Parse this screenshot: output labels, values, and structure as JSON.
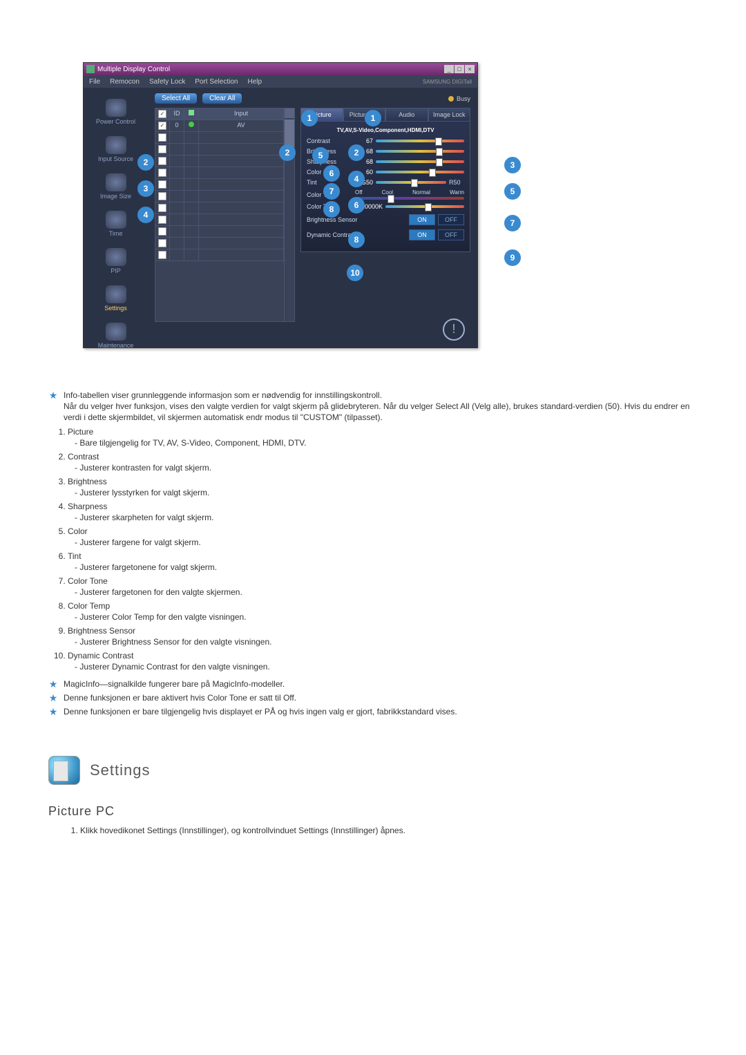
{
  "window": {
    "title": "Multiple Display Control",
    "menu": [
      "File",
      "Remocon",
      "Safety Lock",
      "Port Selection",
      "Help"
    ],
    "brand": "SAMSUNG DIGITall"
  },
  "sidebar": {
    "items": [
      {
        "label": "Power Control"
      },
      {
        "label": "Input Source"
      },
      {
        "label": "Image Size"
      },
      {
        "label": "Time"
      },
      {
        "label": "PIP"
      },
      {
        "label": "Settings"
      },
      {
        "label": "Maintenance"
      }
    ]
  },
  "topButtons": {
    "selectAll": "Select All",
    "clearAll": "Clear All",
    "busy": "Busy"
  },
  "gridHead": {
    "id": "ID",
    "input": "Input"
  },
  "gridRows": [
    {
      "id": "0",
      "input": "AV",
      "checked": true,
      "status": true
    },
    {
      "id": "",
      "input": ""
    },
    {
      "id": "",
      "input": ""
    },
    {
      "id": "",
      "input": ""
    },
    {
      "id": "",
      "input": ""
    },
    {
      "id": "",
      "input": ""
    },
    {
      "id": "",
      "input": ""
    },
    {
      "id": "",
      "input": ""
    },
    {
      "id": "",
      "input": ""
    },
    {
      "id": "",
      "input": ""
    },
    {
      "id": "",
      "input": ""
    },
    {
      "id": "",
      "input": ""
    }
  ],
  "tabs": [
    "Picture",
    "Picture PC",
    "Audio",
    "Image Lock"
  ],
  "panel": {
    "subtitle": "TV,AV,S-Video,Component,HDMI,DTV",
    "contrast": {
      "label": "Contrast",
      "value": "67"
    },
    "brightness": {
      "label": "Brightness",
      "value": "68"
    },
    "sharpness": {
      "label": "Sharpness",
      "value": "68"
    },
    "color": {
      "label": "Color",
      "value": "60"
    },
    "tint": {
      "label": "Tint",
      "left": "G50",
      "right": "R50"
    },
    "colorTone": {
      "label": "Color Tone",
      "opts": [
        "Off",
        "Cool",
        "Normal",
        "Warm"
      ]
    },
    "colorTemp": {
      "label": "Color Temp",
      "value": "10000K"
    },
    "brightnessSensor": {
      "label": "Brightness Sensor",
      "on": "ON",
      "off": "OFF"
    },
    "dynamicContrast": {
      "label": "Dynamic Contrast",
      "on": "ON",
      "off": "OFF"
    }
  },
  "callouts": {
    "c1": "1",
    "c2": "2",
    "c3": "3",
    "c4": "4",
    "c5": "5",
    "c6": "6",
    "c7": "7",
    "c8": "8",
    "c9": "9",
    "c10": "10",
    "s2": "2",
    "s3": "3",
    "s4": "4",
    "s5": "5",
    "s6": "6",
    "s7": "7",
    "s8": "8"
  },
  "intro": {
    "star1a": "Info-tabellen viser grunnleggende informasjon som er nødvendig for innstillingskontroll.",
    "star1b": "Når du velger hver funksjon, vises den valgte verdien for valgt skjerm på glidebryteren. Når du velger Select All (Velg alle), brukes standard-verdien (50). Hvis du endrer en verdi i dette skjermbildet, vil skjermen automatisk endr modus til \"CUSTOM\" (tilpasset)."
  },
  "list": [
    {
      "t": "Picture",
      "d": "- Bare tilgjengelig for TV, AV, S-Video, Component, HDMI, DTV."
    },
    {
      "t": "Contrast",
      "d": "- Justerer kontrasten for valgt skjerm."
    },
    {
      "t": "Brightness",
      "d": "- Justerer lysstyrken for valgt skjerm."
    },
    {
      "t": "Sharpness",
      "d": "- Justerer skarpheten for valgt skjerm."
    },
    {
      "t": "Color",
      "d": "- Justerer fargene for valgt skjerm."
    },
    {
      "t": "Tint",
      "d": "- Justerer fargetonene for valgt skjerm."
    },
    {
      "t": "Color Tone",
      "d": "- Justerer fargetonen for den valgte skjermen."
    },
    {
      "t": "Color Temp",
      "d": "- Justerer Color Temp for den valgte visningen."
    },
    {
      "t": "Brightness Sensor",
      "d": "- Justerer Brightness Sensor for den valgte visningen."
    },
    {
      "t": "Dynamic Contrast",
      "d": "- Justerer Dynamic Contrast for den valgte visningen."
    }
  ],
  "notes2": {
    "n1": "MagicInfo—signalkilde fungerer bare på MagicInfo-modeller.",
    "n2": "Denne funksjonen er bare aktivert hvis Color Tone er satt til Off.",
    "n3": "Denne funksjonen er bare tilgjengelig hvis displayet er PÅ og hvis ingen valg er gjort, fabrikkstandard vises."
  },
  "section": {
    "title": "Settings",
    "sub": "Picture PC"
  },
  "steps": [
    "Klikk hovedikonet Settings (Innstillinger), og kontrollvinduet Settings (Innstillinger) åpnes."
  ]
}
